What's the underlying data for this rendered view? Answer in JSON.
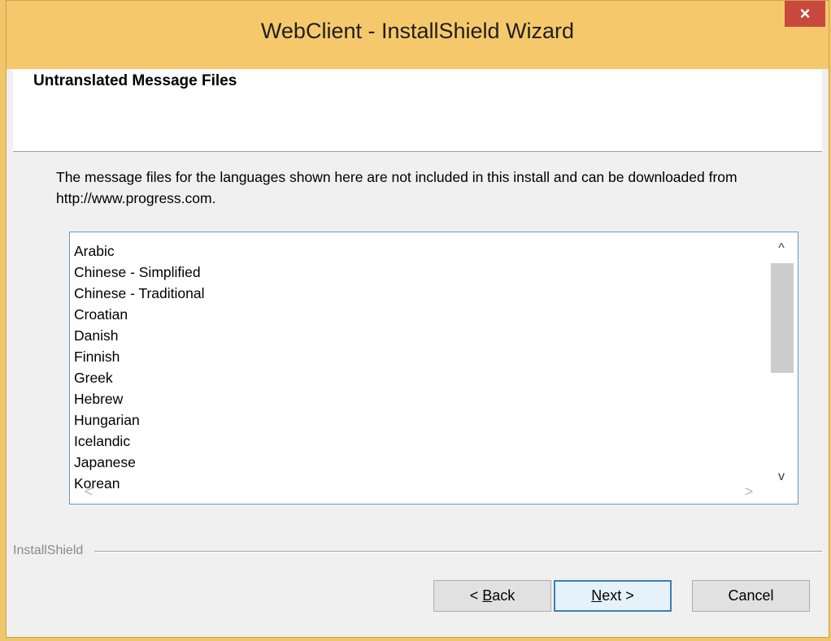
{
  "window": {
    "title": "WebClient - InstallShield Wizard",
    "close_glyph": "×"
  },
  "header": {
    "title": "Untranslated Message Files"
  },
  "description": "The message files for the languages shown here are not included in this install and can be downloaded from http://www.progress.com.",
  "languages": [
    "Arabic",
    "Chinese - Simplified",
    "Chinese - Traditional",
    "Croatian",
    "Danish",
    "Finnish",
    "Greek",
    "Hebrew",
    "Hungarian",
    "Icelandic",
    "Japanese",
    "Korean"
  ],
  "scrollbar": {
    "up_glyph": "^",
    "down_glyph": "v",
    "left_glyph": "<",
    "right_glyph": ">"
  },
  "footer": {
    "brand": "InstallShield"
  },
  "buttons": {
    "back": {
      "prefix": "< ",
      "mnemonic": "B",
      "rest": "ack"
    },
    "next": {
      "mnemonic": "N",
      "rest": "ext >"
    },
    "cancel": "Cancel"
  },
  "colors": {
    "title_bar": "#f5c96b",
    "close_button": "#c8483e",
    "focus_border": "#5b9bd5"
  }
}
